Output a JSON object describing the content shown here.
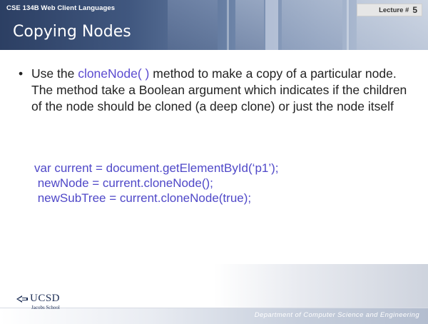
{
  "header": {
    "course": "CSE 134B  Web Client Languages",
    "lecture_label": "Lecture #",
    "lecture_number": "5",
    "title": "Copying Nodes"
  },
  "body": {
    "bullet_prefix": "Use the ",
    "method_name": "cloneNode( )",
    "bullet_suffix": " method to make a copy of a particular node. The method take a Boolean argument which indicates if the children of the node should be cloned (a deep clone) or just the node itself",
    "code_lines": [
      "var current = document.getElementById(‘p1’);",
      " newNode = current.cloneNode();",
      " newSubTree = current.cloneNode(true);"
    ]
  },
  "footer": {
    "logo_text": "UCSD",
    "logo_subtext": "Jacobs School",
    "department": "Department of Computer Science and Engineering"
  },
  "colors": {
    "header_dark": "#2c3f63",
    "method_highlight": "#5b4bd0",
    "code_text": "#4f48c8",
    "logo_navy": "#1e2f56"
  }
}
